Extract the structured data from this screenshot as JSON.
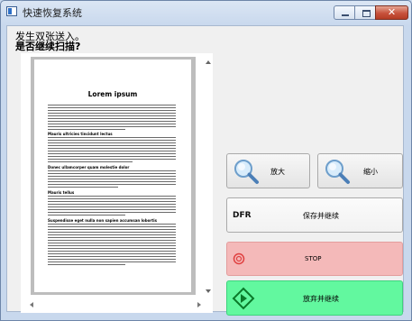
{
  "window": {
    "title": "快速恢复系统",
    "close_glyph": "✕"
  },
  "prompt": {
    "line1": "发生双张送入。",
    "line2": "是否继续扫描?"
  },
  "document": {
    "title": "Lorem ipsum",
    "headings": [
      "Mauris ultricies tincidunt lectus",
      "Donec ullamcorper quam molestie dolor",
      "Mauris tellus",
      "Suspendisse eget nulla non sapien accumsan lobortis"
    ]
  },
  "buttons": {
    "zoom_in": "放大",
    "zoom_out": "缩小",
    "save_badge": "DFR",
    "save": "保存并继续",
    "stop": "STOP",
    "abandon": "放弃并继续"
  },
  "colors": {
    "stop_bg": "#f4b9b9",
    "abandon_bg": "#62f89f",
    "stop_icon": "#e04040",
    "abandon_icon": "#0a7a2a"
  }
}
